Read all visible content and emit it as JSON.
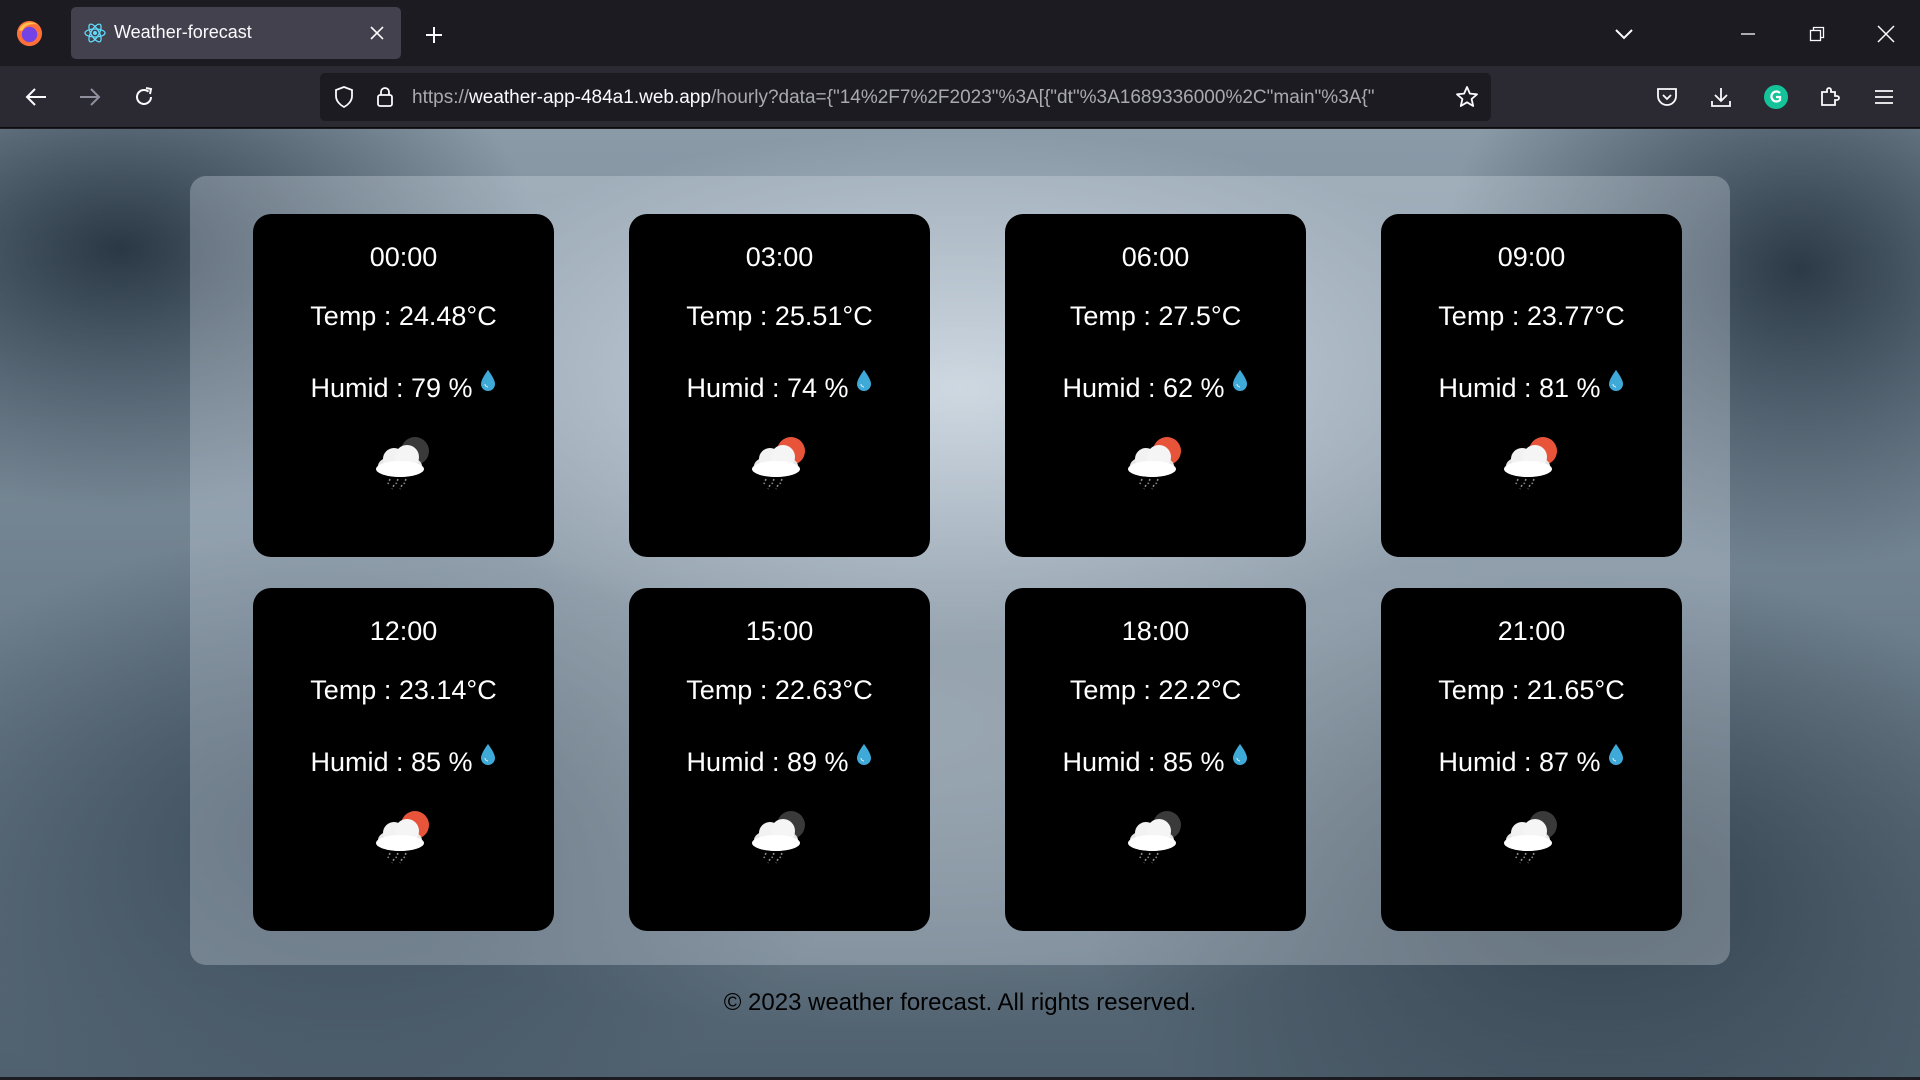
{
  "browser": {
    "tab_title": "Weather-forecast",
    "url_prefix": "https://",
    "url_host": "weather-app-484a1.web.app",
    "url_rest": "/hourly?data={\"14%2F7%2F2023\"%3A[{\"dt\"%3A1689336000%2C\"main\"%3A{\""
  },
  "cards": [
    {
      "time": "00:00",
      "temp": "Temp : 24.48°C",
      "humid": "Humid : 79 %",
      "icon": "cloud-rain-night-icon"
    },
    {
      "time": "03:00",
      "temp": "Temp : 25.51°C",
      "humid": "Humid : 74 %",
      "icon": "cloud-rain-sun-icon"
    },
    {
      "time": "06:00",
      "temp": "Temp : 27.5°C",
      "humid": "Humid : 62 %",
      "icon": "cloud-rain-sun-icon"
    },
    {
      "time": "09:00",
      "temp": "Temp : 23.77°C",
      "humid": "Humid : 81 %",
      "icon": "cloud-rain-sun-icon"
    },
    {
      "time": "12:00",
      "temp": "Temp : 23.14°C",
      "humid": "Humid : 85 %",
      "icon": "cloud-rain-sun-icon"
    },
    {
      "time": "15:00",
      "temp": "Temp : 22.63°C",
      "humid": "Humid : 89 %",
      "icon": "cloud-rain-night-icon"
    },
    {
      "time": "18:00",
      "temp": "Temp : 22.2°C",
      "humid": "Humid : 85 %",
      "icon": "cloud-rain-night-icon"
    },
    {
      "time": "21:00",
      "temp": "Temp : 21.65°C",
      "humid": "Humid : 87 %",
      "icon": "cloud-rain-night-icon"
    }
  ],
  "footer": {
    "text": "© 2023 weather forecast. All rights reserved."
  },
  "colors": {
    "sun": "#e8543a",
    "moon": "#3a3a3a",
    "drop": "#3fa9d8"
  }
}
